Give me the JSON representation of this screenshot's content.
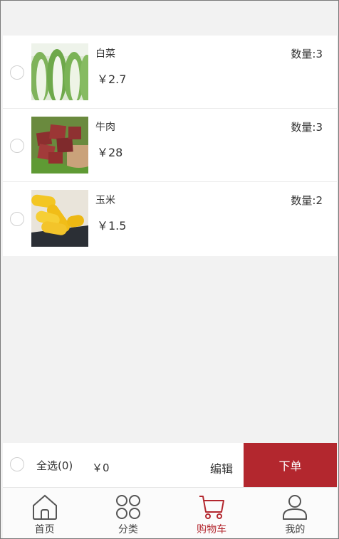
{
  "cart": {
    "items": [
      {
        "name": "白菜",
        "price": "￥2.7",
        "quantity": "数量:3",
        "image": "napa-cabbage"
      },
      {
        "name": "牛肉",
        "price": "￥28",
        "quantity": "数量:3",
        "image": "beef-cubes"
      },
      {
        "name": "玉米",
        "price": "￥1.5",
        "quantity": "数量:2",
        "image": "corn-cobs"
      }
    ]
  },
  "footer": {
    "select_all": "全选(0)",
    "total": "￥0",
    "edit": "编辑",
    "order": "下单",
    "order_color": "#b3272e"
  },
  "tabbar": {
    "tabs": [
      {
        "label": "首页",
        "icon": "home-icon"
      },
      {
        "label": "分类",
        "icon": "category-icon"
      },
      {
        "label": "购物车",
        "icon": "cart-icon",
        "active": true
      },
      {
        "label": "我的",
        "icon": "user-icon"
      }
    ],
    "active_color": "#b3272e"
  }
}
